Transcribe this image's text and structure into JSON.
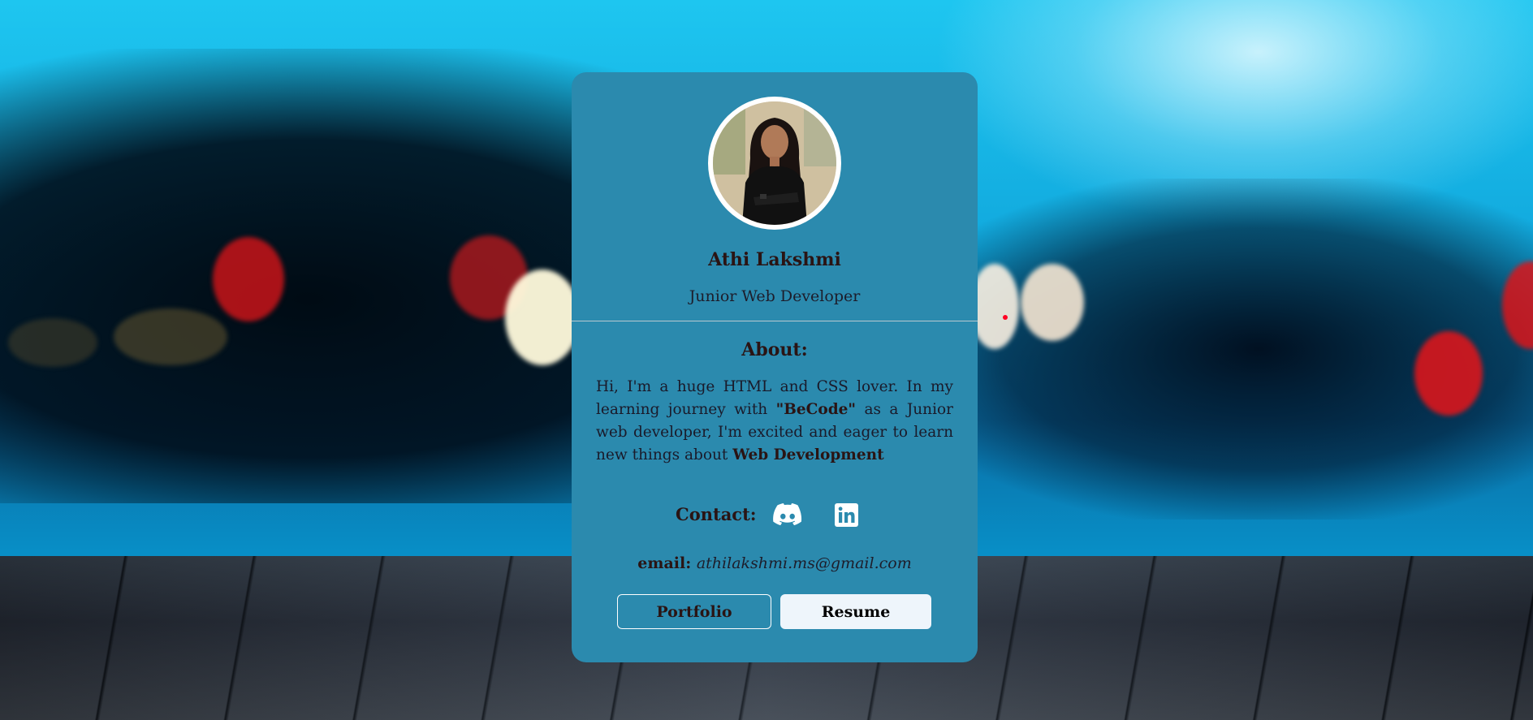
{
  "profile": {
    "name": "Athi Lakshmi",
    "role": "Junior Web Developer"
  },
  "about": {
    "title": "About:",
    "text_part1": "Hi, I'm a huge HTML and CSS lover. In my learning journey with ",
    "highlight1": "\"BeCode\"",
    "text_part2": " as a Junior web developer, I'm excited and eager to learn new things about ",
    "highlight2": "Web Development"
  },
  "contact": {
    "label": "Contact:",
    "icons": [
      "discord-icon",
      "linkedin-icon"
    ]
  },
  "email": {
    "label": "email:",
    "value": "athilakshmi.ms@gmail.com"
  },
  "buttons": {
    "portfolio": "Portfolio",
    "resume": "Resume"
  },
  "colors": {
    "card": "#2b8aae",
    "resume_button": "#eef5fb"
  }
}
